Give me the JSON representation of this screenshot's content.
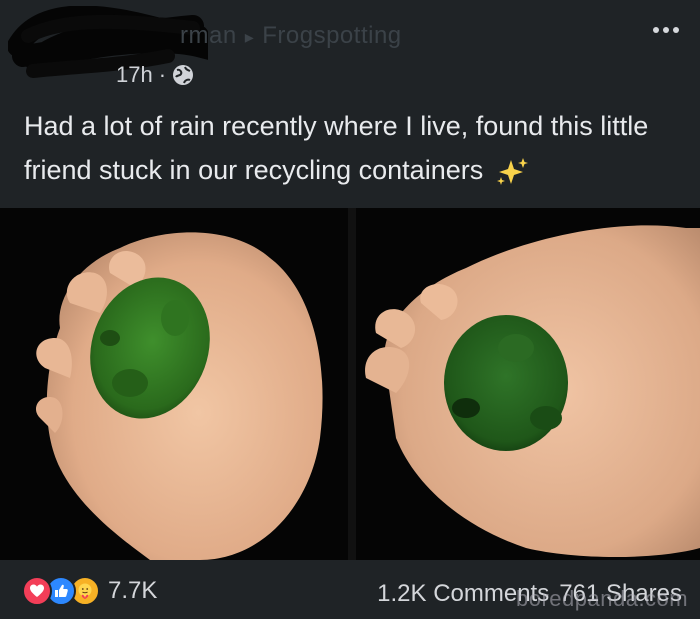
{
  "header": {
    "author_partial": "rman",
    "group_name": "Frogspotting",
    "separator": "▸",
    "time": "17h",
    "dot": "·"
  },
  "caption": {
    "text": "Had a lot of rain recently where I live, found this little friend stuck in our recycling containers"
  },
  "footer": {
    "reaction_count": "7.7K",
    "comments": "1.2K Comments",
    "shares": "761 Shares"
  },
  "watermark": "boredpanda.com",
  "colors": {
    "background": "#1f2326",
    "love": "#f33e58",
    "like": "#2d88ff",
    "care": "#f7b125"
  }
}
